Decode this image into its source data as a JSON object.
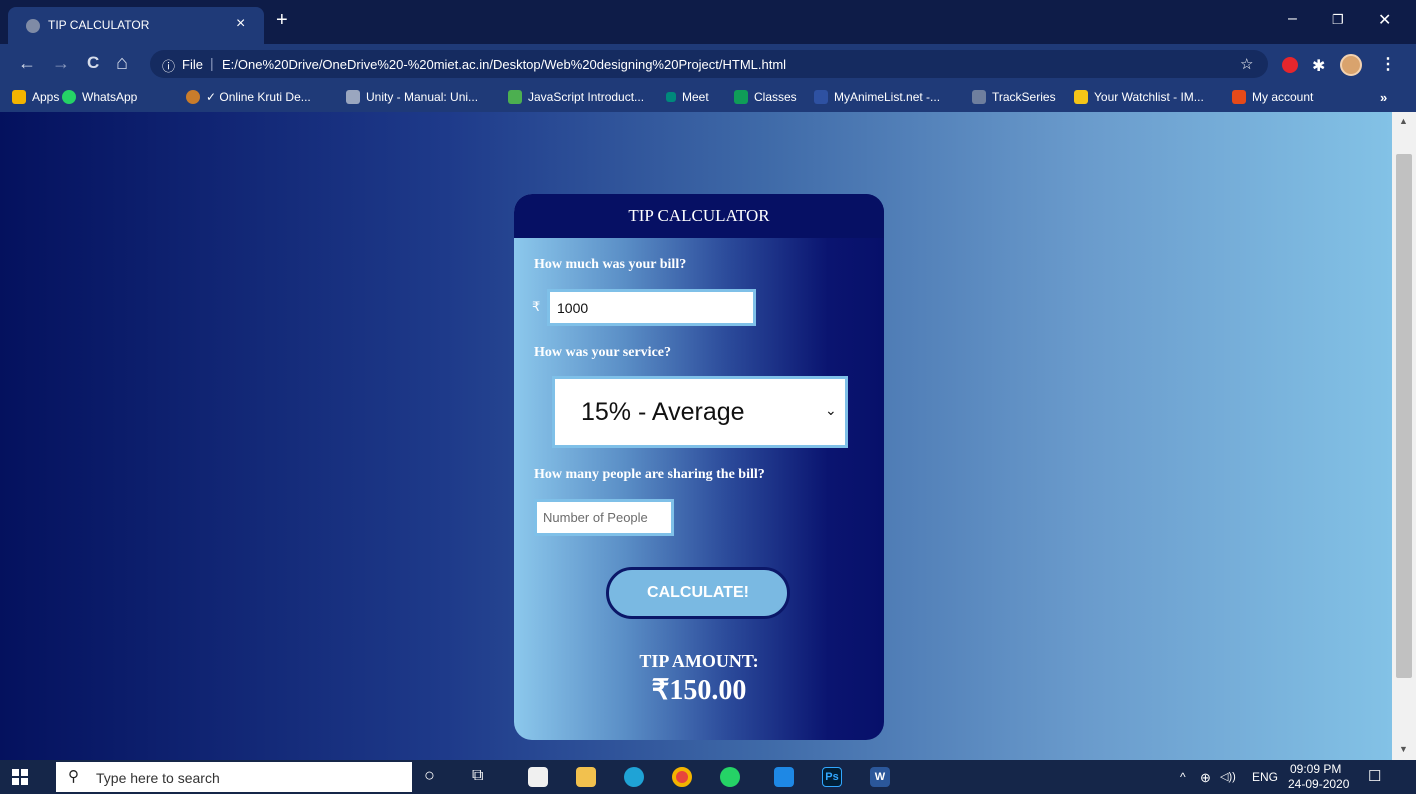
{
  "browser": {
    "tab_title": "TIP CALCULATOR",
    "close_glyph": "×",
    "new_tab_glyph": "+",
    "minimize_glyph": "–",
    "restore_glyph": "❐",
    "window_close_glyph": "✕",
    "address": {
      "info_glyph": "ⓘ",
      "scheme_label": "File",
      "separator": "|",
      "url": "E:/One%20Drive/OneDrive%20-%20miet.ac.in/Desktop/Web%20designing%20Project/HTML.html",
      "star_glyph": "☆"
    },
    "nav": {
      "back": "←",
      "forward": "→",
      "reload": "C",
      "home": "⌂"
    },
    "menu_glyph": "⋮",
    "puzzle_glyph": "✱",
    "bookmarks": [
      {
        "label": "Apps",
        "color": "#f4b400"
      },
      {
        "label": "WhatsApp",
        "color": "#25d366"
      },
      {
        "label": "✓ Online Kruti De...",
        "color": "#c97c2b"
      },
      {
        "label": "Unity - Manual: Uni...",
        "color": "#9aa6bf"
      },
      {
        "label": "JavaScript Introduct...",
        "color": "#4caf50"
      },
      {
        "label": "Meet",
        "color": "#00897b"
      },
      {
        "label": "Classes",
        "color": "#0f9d58"
      },
      {
        "label": "MyAnimeList.net -...",
        "color": "#2e51a2"
      },
      {
        "label": "TrackSeries",
        "color": "#6f7f9e"
      },
      {
        "label": "Your Watchlist - IM...",
        "color": "#f5c518"
      },
      {
        "label": "My account",
        "color": "#e64a19"
      }
    ],
    "bookmarks_more": "»"
  },
  "calculator": {
    "title": "TIP CALCULATOR",
    "bill_question": "How much was your bill?",
    "currency_symbol": "₹",
    "bill_value": "1000",
    "service_question": "How was your service?",
    "service_selected": "15% - Average",
    "service_caret": "⌄",
    "people_question": "How many people are sharing the bill?",
    "people_placeholder": "Number of People",
    "calculate_label": "CALCULATE!",
    "tip_label": "TIP AMOUNT:",
    "tip_value": "₹150.00"
  },
  "scrollbar": {
    "up": "▲",
    "down": "▼"
  },
  "taskbar": {
    "search_placeholder": "Type here to search",
    "search_glyph": "⚲",
    "cortana_glyph": "○",
    "taskview_glyph": "⧉",
    "ps_label": "Ps",
    "word_label": "W",
    "tray_chevron": "^",
    "tray_network": "⊕",
    "tray_volume": "◁))",
    "language": "ENG",
    "time": "09:09 PM",
    "date": "24-09-2020",
    "notification_glyph": "☐"
  }
}
